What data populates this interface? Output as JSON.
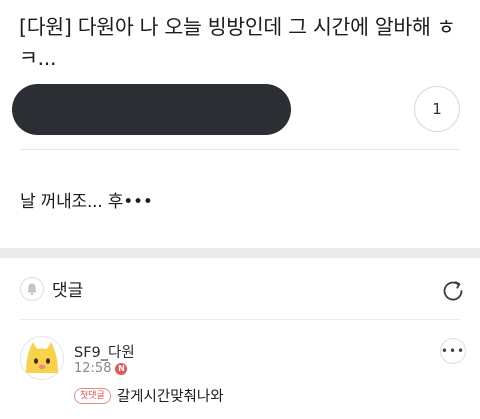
{
  "post": {
    "title": "[다원] 다원아 나 오늘 빙방인데 그 시간에 알바해 ㅎㅋ...",
    "comment_count": "1",
    "body": "날 꺼내조... 후•••"
  },
  "comments": {
    "label": "댓글",
    "items": [
      {
        "author": "SF9_다원",
        "time": "12:58",
        "new_badge": "N",
        "first_badge": "첫댓글",
        "text": "갈게시간맞춰나와"
      }
    ]
  },
  "colors": {
    "author_pill": "#2b2f33",
    "separator": "#ebebed",
    "new_badge": "#e85656",
    "first_badge": "#e05555",
    "avatar": "#f7d24a"
  },
  "icons": {
    "notify": "bell-icon",
    "refresh": "refresh-icon",
    "more": "more-icon"
  }
}
